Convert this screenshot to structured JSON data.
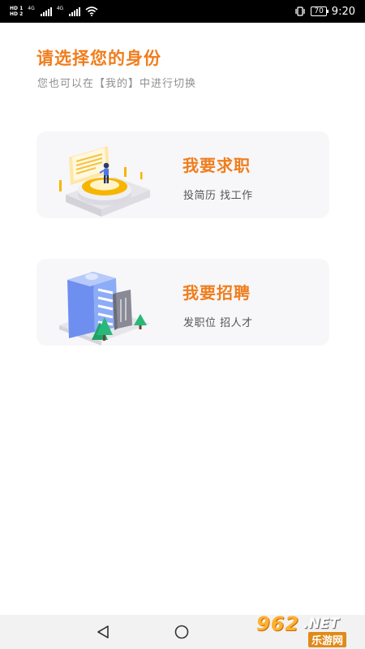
{
  "status_bar": {
    "sim1": "HD 1",
    "sim2": "HD 2",
    "network1": "4G",
    "network2": "4G",
    "battery": "70",
    "time": "9:20"
  },
  "header": {
    "title": "请选择您的身份",
    "subtitle": "您也可以在【我的】中进行切换"
  },
  "cards": [
    {
      "title": "我要求职",
      "desc": "投简历 找工作",
      "icon": "job-seeker-illustration"
    },
    {
      "title": "我要招聘",
      "desc": "发职位 招人才",
      "icon": "recruiter-building-illustration"
    }
  ],
  "nav": {
    "back": "back-icon",
    "home": "home-icon"
  },
  "watermark": {
    "brand": "962",
    "net": ".NET",
    "site": "乐游网"
  },
  "colors": {
    "accent": "#f07d1c",
    "card_bg": "#f7f7f9"
  }
}
